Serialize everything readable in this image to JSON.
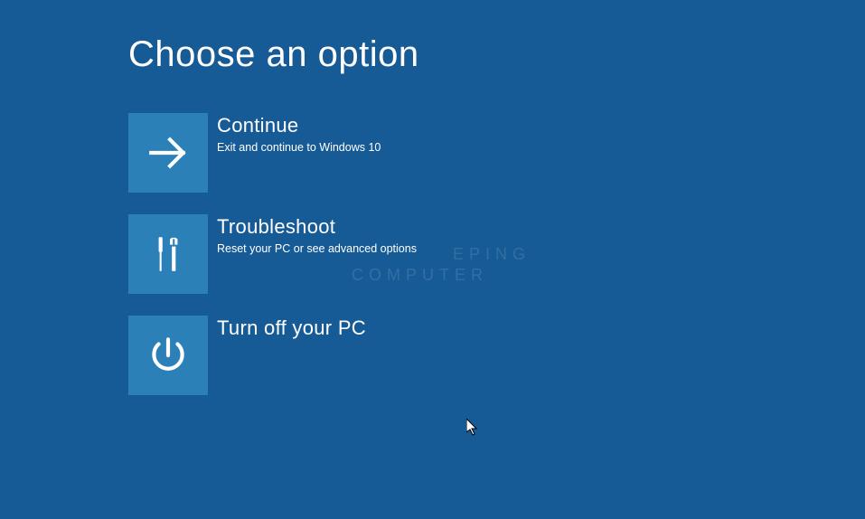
{
  "page": {
    "title": "Choose an option"
  },
  "options": {
    "continue": {
      "title": "Continue",
      "desc": "Exit and continue to Windows 10"
    },
    "troubleshoot": {
      "title": "Troubleshoot",
      "desc": "Reset your PC or see advanced options"
    },
    "turnoff": {
      "title": "Turn off your PC",
      "desc": ""
    }
  },
  "watermark": {
    "line1": "EPING",
    "line2": "COMPUTER"
  },
  "colors": {
    "background": "#175b96",
    "tile": "#2c80b8"
  }
}
